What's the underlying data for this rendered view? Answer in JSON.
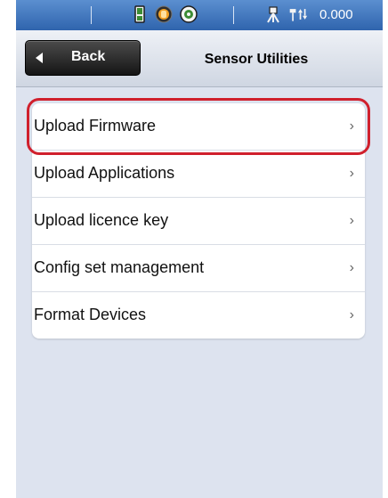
{
  "status_bar": {
    "value": "0.000",
    "icons": [
      "battery-icon",
      "stop-icon",
      "target-icon",
      "tripod-icon",
      "signal-icon"
    ],
    "color": "#2f64ad"
  },
  "header": {
    "back_label": "Back",
    "title": "Sensor Utilities"
  },
  "menu": {
    "items": [
      {
        "label": "Upload Firmware",
        "chevron": "›"
      },
      {
        "label": "Upload Applications",
        "chevron": "›"
      },
      {
        "label": "Upload licence key",
        "chevron": "›"
      },
      {
        "label": "Config set management",
        "chevron": "›"
      },
      {
        "label": "Format Devices",
        "chevron": "›"
      }
    ],
    "highlight_color": "#d0202d"
  }
}
